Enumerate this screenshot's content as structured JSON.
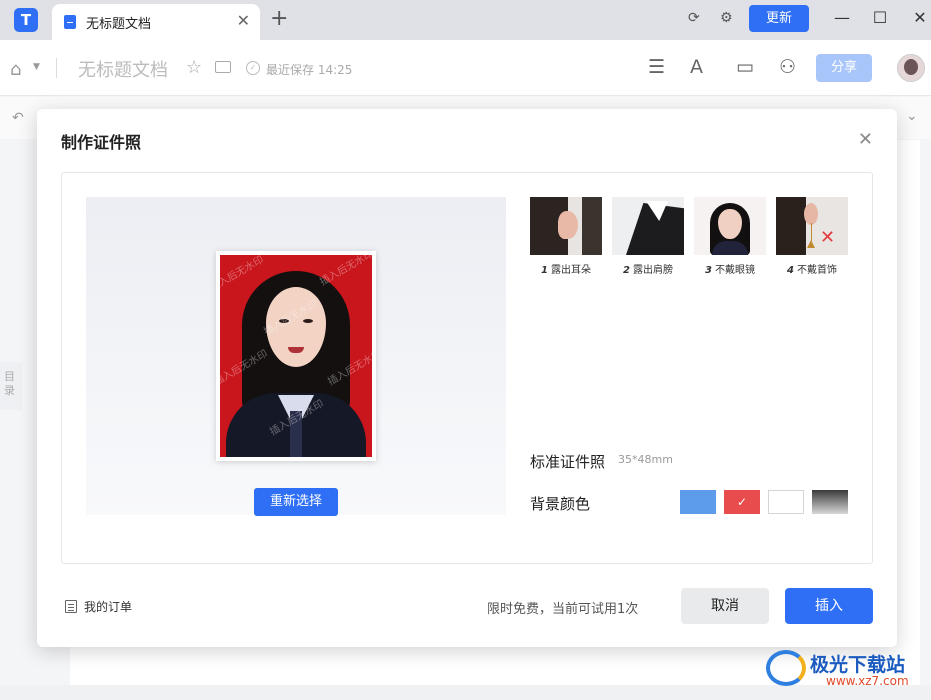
{
  "app": {
    "tab_title": "无标题文档",
    "update_label": "更新"
  },
  "toolbar": {
    "doc_title": "无标题文档",
    "saved_text": "最近保存 14:25",
    "share_label": "分享"
  },
  "sidebar": {
    "toc_label": "目录"
  },
  "dialog": {
    "title": "制作证件照",
    "reselect_label": "重新选择",
    "watermark_text": "插入后无水印",
    "requirements": [
      {
        "num": "1",
        "label": "露出耳朵"
      },
      {
        "num": "2",
        "label": "露出肩膀"
      },
      {
        "num": "3",
        "label": "不戴眼镜"
      },
      {
        "num": "4",
        "label": "不戴首饰"
      }
    ],
    "spec_label": "标准证件照",
    "spec_size": "35*48mm",
    "bg_color_label": "背景颜色",
    "bg_colors": [
      {
        "name": "blue",
        "hex": "#5d9ceb",
        "selected": false
      },
      {
        "name": "red",
        "hex": "#e84c4c",
        "selected": true
      },
      {
        "name": "white",
        "hex": "#ffffff",
        "selected": false
      },
      {
        "name": "gray-gradient",
        "hex": "#3a3a3a",
        "selected": false
      }
    ],
    "orders_label": "我的订单",
    "trial_text": "限时免费，当前可试用1次",
    "cancel_label": "取消",
    "insert_label": "插入"
  },
  "watermark_site": {
    "name": "极光下载站",
    "url": "www.xz7.com"
  }
}
